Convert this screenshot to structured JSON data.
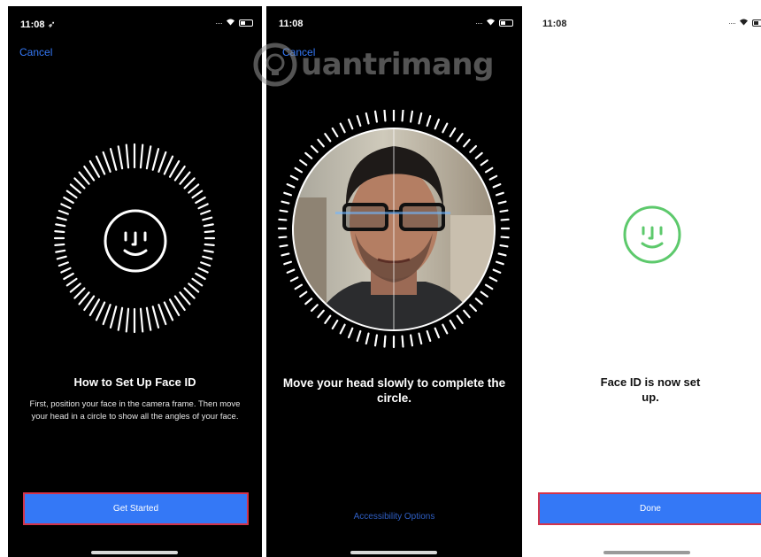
{
  "colors": {
    "accent": "#3478f6",
    "success": "#5dc96c",
    "highlight_border": "#d3344a"
  },
  "watermark": {
    "text": "uantrimang"
  },
  "screens": [
    {
      "status_time": "11:08 ➶",
      "cancel_label": "Cancel",
      "title": "How to Set Up Face ID",
      "description": "First, position your face in the camera frame. Then move your head in a circle to show all the angles of your face.",
      "button_label": "Get Started",
      "icon": "face-id-icon"
    },
    {
      "status_time": "11:08",
      "cancel_label": "Cancel",
      "title": "Move your head slowly to complete the circle.",
      "link_label": "Accessibility Options",
      "icon": "camera-face-preview"
    },
    {
      "status_time": "11:08",
      "title": "Face ID is now set up.",
      "button_label": "Done",
      "icon": "face-id-success-icon"
    }
  ]
}
